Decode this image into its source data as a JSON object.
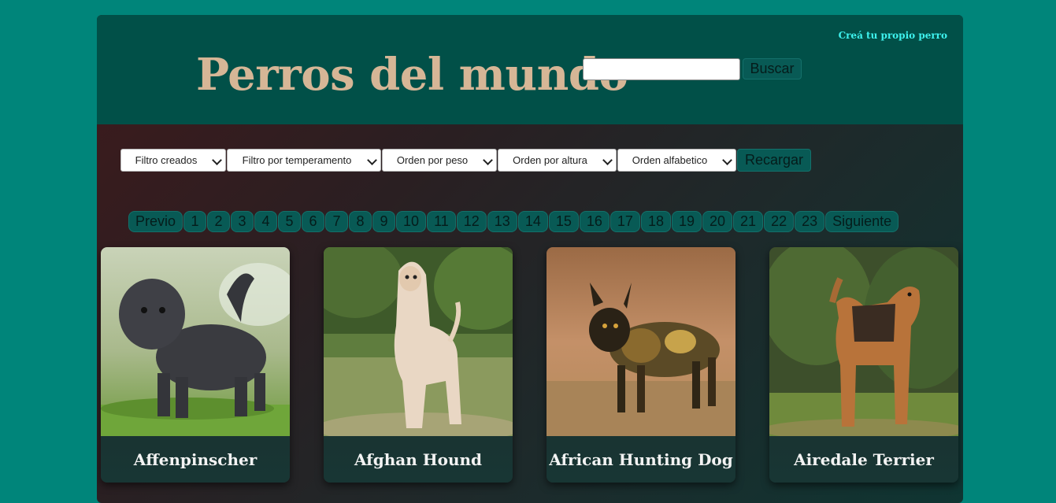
{
  "header": {
    "create_link": "Creá tu propio perro",
    "title": "Perros del mundo",
    "search": {
      "value": "",
      "placeholder": "",
      "button": "Buscar"
    }
  },
  "filters": {
    "created": "Filtro creados",
    "temperament": "Filtro por temperamento",
    "weight": "Orden por peso",
    "height": "Orden por altura",
    "alpha": "Orden alfabetico",
    "reload": "Recargar"
  },
  "pagination": {
    "prev": "Previo",
    "pages": [
      "1",
      "2",
      "3",
      "4",
      "5",
      "6",
      "7",
      "8",
      "9",
      "10",
      "11",
      "12",
      "13",
      "14",
      "15",
      "16",
      "17",
      "18",
      "19",
      "20",
      "21",
      "22",
      "23"
    ],
    "next": "Siguiente"
  },
  "cards": [
    {
      "name": "Affenpinscher",
      "icon": "affenpinscher-photo"
    },
    {
      "name": "Afghan Hound",
      "icon": "afghan-hound-photo"
    },
    {
      "name": "African Hunting Dog",
      "icon": "african-hunting-dog-photo"
    },
    {
      "name": "Airedale Terrier",
      "icon": "airedale-terrier-photo"
    }
  ],
  "colors": {
    "page_bg": "#00857a",
    "header_bg": "#015048",
    "title": "#d6b696",
    "link": "#3ef2ee",
    "button_bg": "#085a55"
  }
}
